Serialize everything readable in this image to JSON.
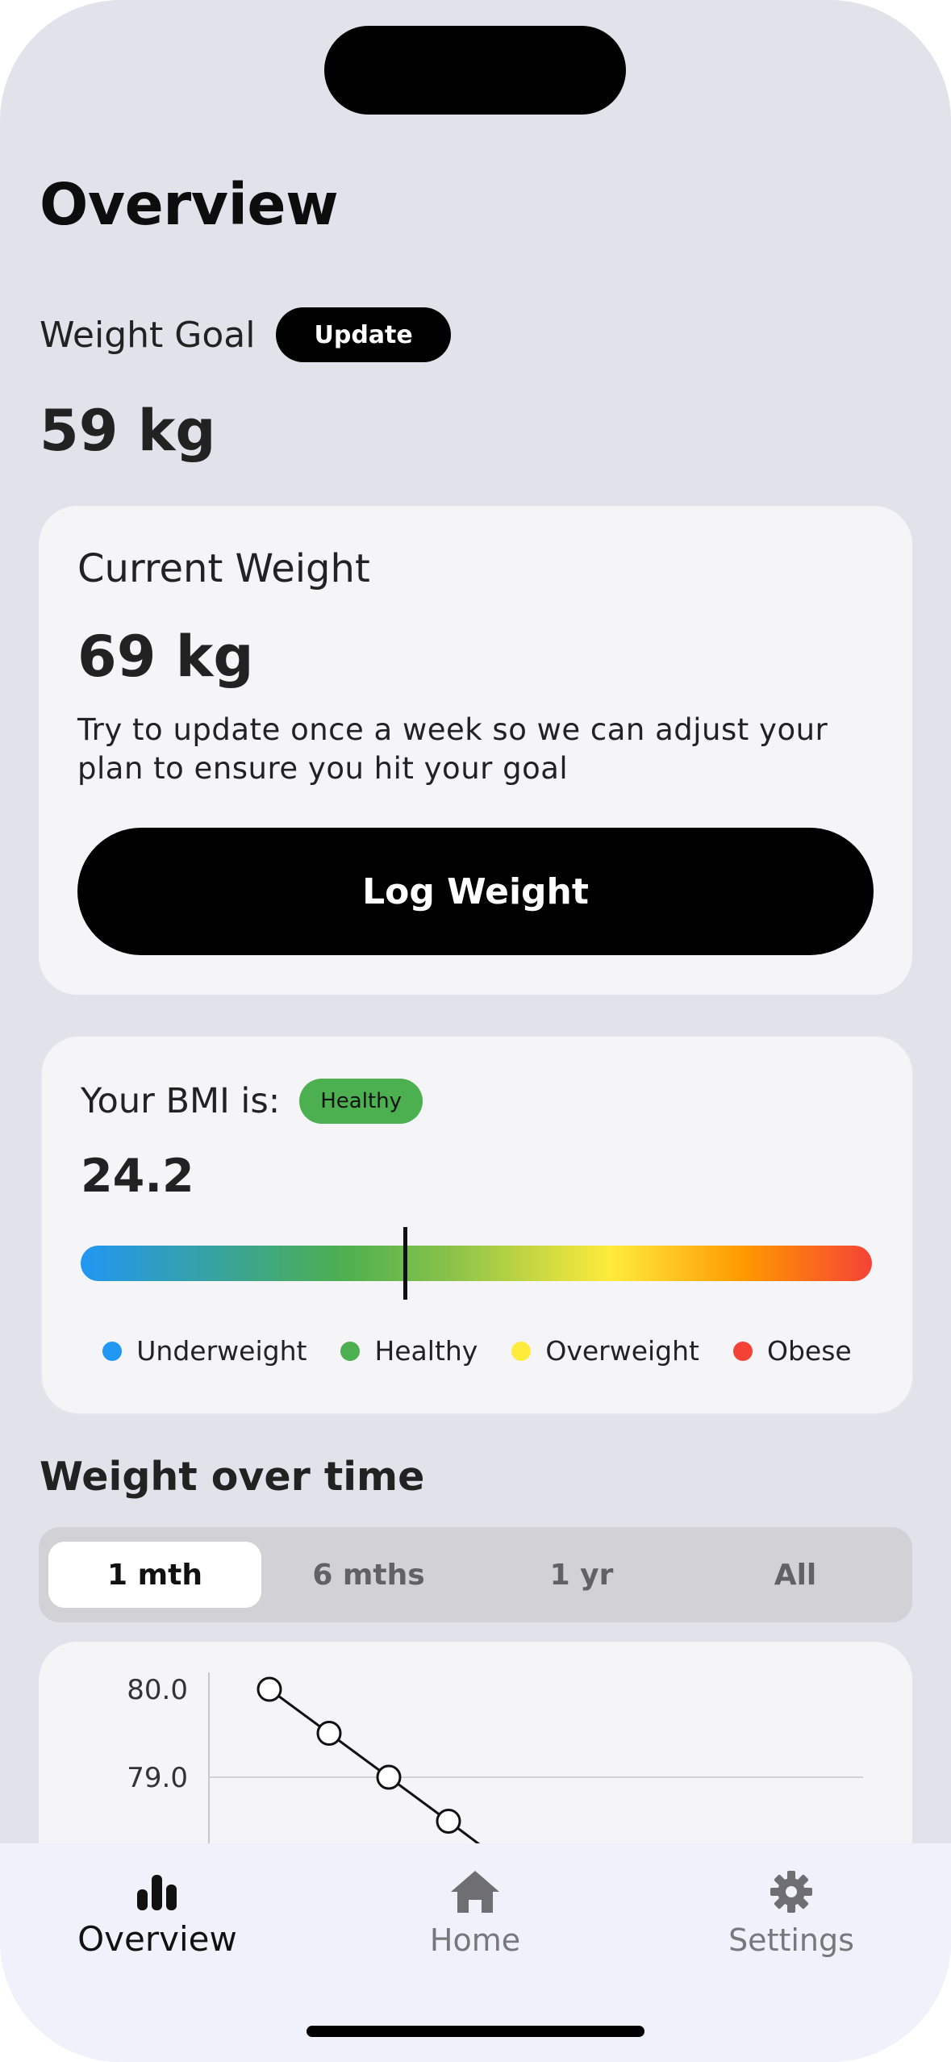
{
  "page_title": "Overview",
  "weight_goal": {
    "label": "Weight Goal",
    "update_label": "Update",
    "value": "59 kg"
  },
  "current_weight": {
    "title": "Current Weight",
    "value": "69 kg",
    "description": "Try to update once a week so we can adjust your plan to ensure you hit your goal",
    "log_button": "Log Weight"
  },
  "bmi": {
    "label": "Your BMI is:",
    "badge": "Healthy",
    "value": "24.2",
    "marker_fraction": 0.41,
    "legend": [
      {
        "label": "Underweight",
        "color": "#2196f3"
      },
      {
        "label": "Healthy",
        "color": "#4caf50"
      },
      {
        "label": "Overweight",
        "color": "#ffeb3b"
      },
      {
        "label": "Obese",
        "color": "#f44336"
      }
    ]
  },
  "weight_over_time": {
    "title": "Weight over time",
    "ranges": [
      "1 mth",
      "6 mths",
      "1 yr",
      "All"
    ],
    "active_range": 0
  },
  "chart_data": {
    "type": "line",
    "y_tick_labels": [
      "80.0",
      "79.0"
    ],
    "y": [
      80.0,
      79.5,
      79.0,
      78.5
    ],
    "grid": true
  },
  "tabbar": {
    "items": [
      {
        "label": "Overview",
        "icon": "bar-chart-icon",
        "active": true
      },
      {
        "label": "Home",
        "icon": "home-icon",
        "active": false
      },
      {
        "label": "Settings",
        "icon": "gear-icon",
        "active": false
      }
    ]
  }
}
